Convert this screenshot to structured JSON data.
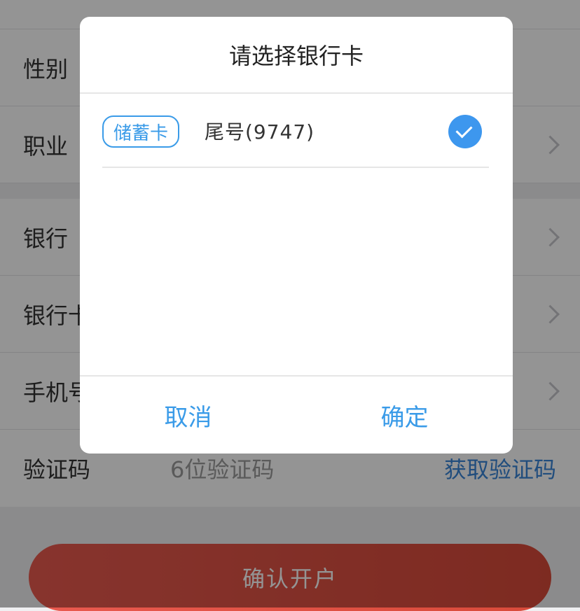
{
  "form": {
    "rows_top": [
      {
        "label": "性别"
      },
      {
        "label": "职业"
      }
    ],
    "rows_bottom": [
      {
        "label": "银行"
      },
      {
        "label": "银行卡"
      },
      {
        "label": "手机号"
      },
      {
        "label": "验证码",
        "placeholder": "6位验证码",
        "action": "获取验证码"
      }
    ]
  },
  "confirm_button": "确认开户",
  "modal": {
    "title": "请选择银行卡",
    "card": {
      "type": "储蓄卡",
      "tail": "尾号(9747)",
      "selected": true
    },
    "cancel": "取消",
    "ok": "确定"
  }
}
